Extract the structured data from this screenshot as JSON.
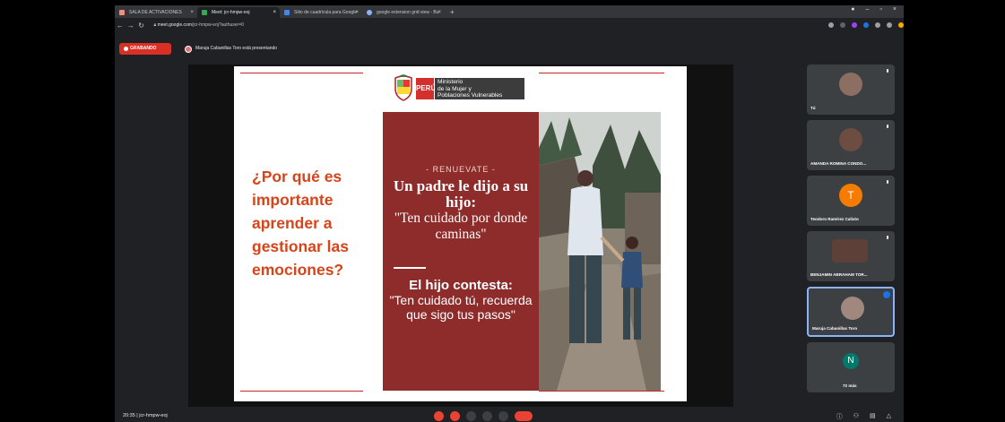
{
  "browser": {
    "tabs": [
      {
        "label": "SALA DE ACTIVACIONES",
        "color": "#f28b82"
      },
      {
        "label": "Meet: jcr-hmpw-eoj",
        "color": "#34a853",
        "active": true
      },
      {
        "label": "Sitio de cuadrícula para Google",
        "color": "#4285f4"
      },
      {
        "label": "google extension grid view - Bu",
        "color": "#8ab4f8"
      }
    ],
    "new_tab": "+",
    "url_host": "meet.google.com",
    "url_path": "/jcr-hmpw-eoj?authuser=0"
  },
  "meet": {
    "recording_label": "GRABANDO",
    "presenter_text": "Maruja Cabanillas Toro está presentando",
    "clock": "20:35  |  jcr-hmpw-eoj",
    "participants": [
      {
        "name": "Tú",
        "avatar_color": "#8d6e63",
        "type": "photo"
      },
      {
        "name": "AMANDA ROMINA CONDO...",
        "avatar_color": "#6d4c41",
        "type": "photo"
      },
      {
        "name": "Teodoro Ramírez Calixto",
        "avatar_color": "#f57c00",
        "type": "letter",
        "letter": "T"
      },
      {
        "name": "BENJAMIN ABRAHAM TOR...",
        "avatar_color": "#5d4037",
        "type": "photo"
      },
      {
        "name": "Maruja Cabanillas Toro",
        "avatar_color": "#a1887f",
        "type": "photo",
        "active": true
      },
      {
        "name": "72 más",
        "avatar_color": "#00796b",
        "type": "letter",
        "letter": "N"
      }
    ]
  },
  "slide": {
    "peru_label": "PERÚ",
    "ministry_lines": [
      "Ministerio",
      "de la Mujer y",
      "Poblaciones Vulnerables"
    ],
    "question": "¿Por qué es importante aprender a gestionar las emociones?",
    "kicker": "- RENUEVATE -",
    "headline": "Un padre le dijo a su hijo:",
    "quote": "\"Ten cuidado por donde caminas\"",
    "answer_intro": "El hijo contesta:",
    "answer_quote": "\"Ten cuidado tú, recuerda que sigo tus pasos\"",
    "accent": "#d6451a",
    "panel_color": "#8e2b2b"
  }
}
